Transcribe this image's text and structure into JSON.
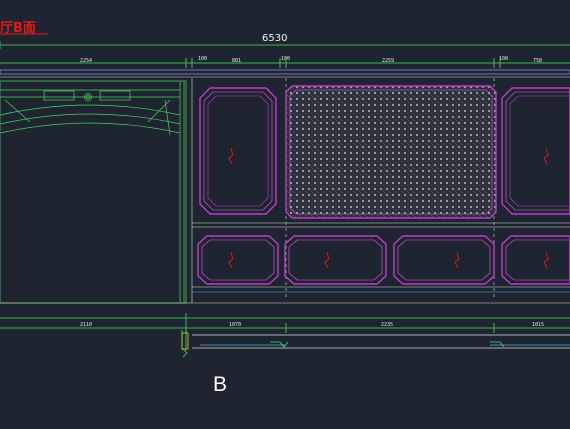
{
  "drawing": {
    "title": "厅B面",
    "overall_width": "6530",
    "top_dims": [
      "2254",
      "100",
      "801",
      "100",
      "2259",
      "100",
      "758"
    ],
    "bottom_dims": [
      "2110",
      "1070",
      "2235",
      "1015"
    ],
    "elevation_label": "B",
    "colors": {
      "background": "#1f2530",
      "panel_magenta": "#c13bd0",
      "panel_inner": "#e85fe0",
      "dimension_line": "#48e05a",
      "arch_line": "#4fd163",
      "white_line": "#d8d8d8",
      "red_mark": "#e0191b"
    },
    "icons": [
      "arch-molding-icon",
      "lattice-panel-icon",
      "break-line-icon"
    ]
  }
}
